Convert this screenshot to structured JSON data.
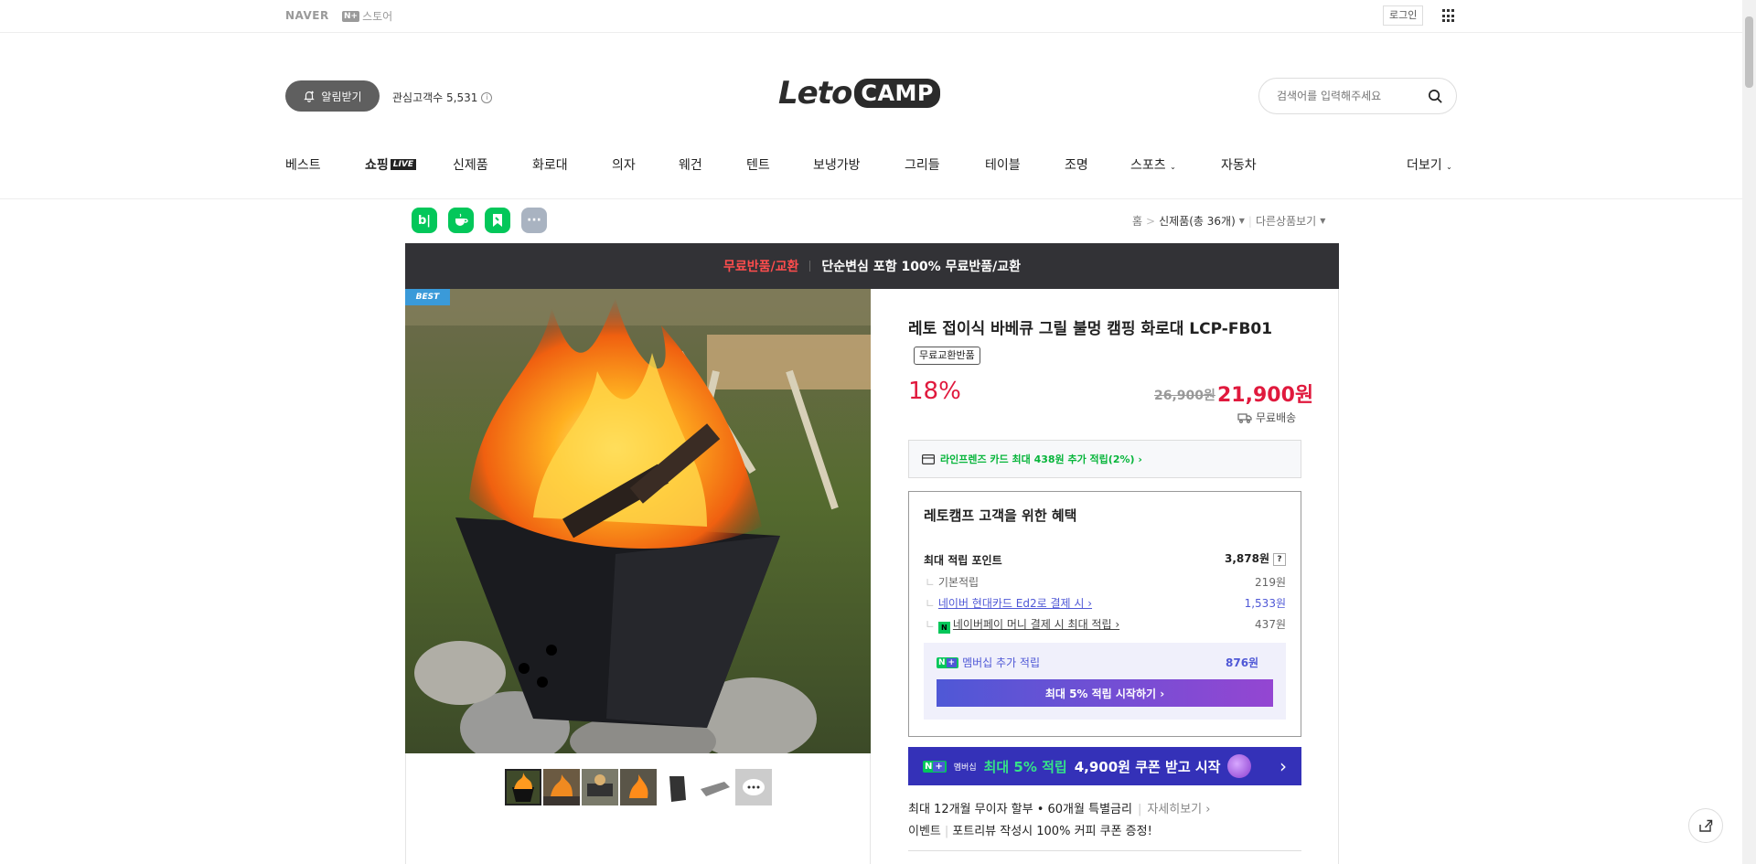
{
  "topbar": {
    "naver": "NAVER",
    "nplus_badge": "N+",
    "store": "스토어",
    "login": "로그인"
  },
  "header": {
    "alarm": "알림받기",
    "interest": "관심고객수 5,531",
    "logo_leto": "Leto",
    "logo_camp": "CAMP",
    "search_placeholder": "검색어를 입력해주세요"
  },
  "nav": {
    "items": [
      "베스트",
      "쇼핑",
      "신제품",
      "화로대",
      "의자",
      "웨건",
      "텐트",
      "보냉가방",
      "그리들",
      "테이블",
      "조명",
      "스포츠",
      "자동차",
      "더보기"
    ],
    "live_badge": "LIVE"
  },
  "breadcrumb": {
    "home": "홈",
    "category": "신제품(총 36개)",
    "other": "다른상품보기"
  },
  "banner": {
    "red": "무료반품/교환",
    "white": "단순변심 포함 100% 무료반품/교환"
  },
  "product": {
    "best": "BEST",
    "title": "레토 접이식 바베큐 그릴 불멍 캠핑 화로대 LCP-FB01",
    "free_tag": "무료교환반품",
    "discount": "18%",
    "old_price": "26,900원",
    "price": "21,900원",
    "shipping": "무료배송",
    "card_benefit": "라인프렌즈 카드 최대 438원 추가 적립(2%) ›"
  },
  "benefit": {
    "title": "레토캠프 고객을 위한 혜택",
    "max_label": "최대 적립 포인트",
    "max_value": "3,878원",
    "rows": [
      {
        "label": "기본적립",
        "value": "219원"
      },
      {
        "label": "네이버 현대카드 Ed2로 결제 시 ›",
        "value": "1,533원"
      },
      {
        "label": "네이버페이 머니 결제 시 최대 적립 ›",
        "value": "437원"
      }
    ],
    "member_label": "멤버십 추가 적립",
    "member_value": "876원",
    "member_btn": "최대 5% 적립 시작하기 ›"
  },
  "promo": {
    "badge": "멤버십",
    "highlight": "최대 5% 적립",
    "rest": "4,900원 쿠폰 받고 시작",
    "arrow": "›"
  },
  "installment": {
    "text": "최대 12개월 무이자 할부 • 60개월 특별금리",
    "more": "자세히보기 ›"
  },
  "event": {
    "tag": "이벤트",
    "text": "포트리뷰 작성시 100% 커피 쿠폰 증정!"
  },
  "icons": {
    "b": "b|",
    "more": "···"
  },
  "colors": {
    "sale_red": "#e0193d",
    "naver_green": "#03c75a",
    "member_purple": "#4f58d6",
    "banner_dark": "#323236"
  }
}
